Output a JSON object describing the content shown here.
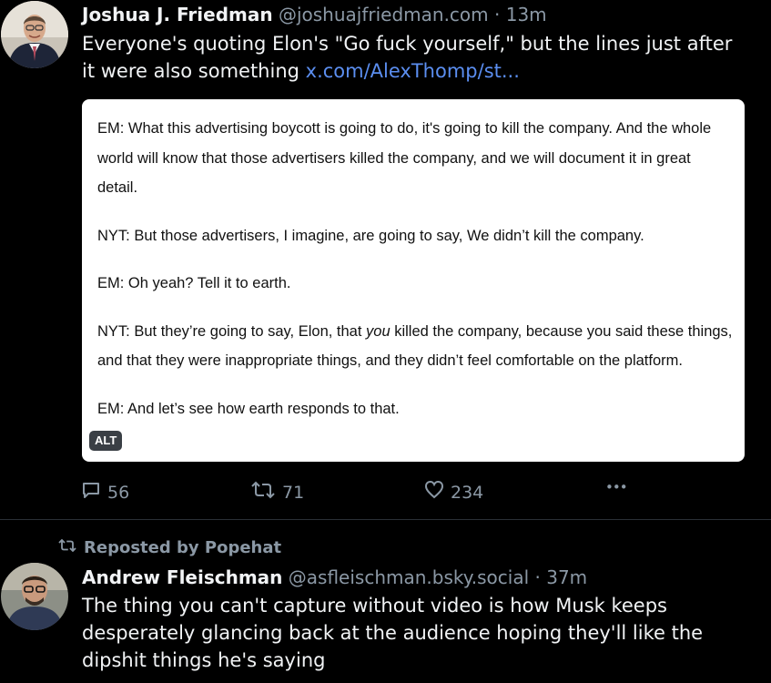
{
  "post1": {
    "author_name": "Joshua J. Friedman",
    "handle": "@joshuajfriedman.com",
    "separator": "·",
    "time": "13m",
    "text": "Everyone's quoting Elon's \"Go fuck yourself,\" but the lines just after it were also something ",
    "link": "x.com/AlexThomp/st...",
    "embed": {
      "p1": "EM: What this advertising boycott is going to do, it's going to kill the company. And the whole world will know that those advertisers killed the company, and we will document it in great detail.",
      "p2": "NYT: But those advertisers, I imagine, are going to say, We didn’t kill the company.",
      "p3": "EM: Oh yeah? Tell it to earth.",
      "p4_a": "NYT: But they’re going to say, Elon, that ",
      "p4_em": "you",
      "p4_b": " killed the company, because you said these things, and that they were inappropriate things, and they didn’t feel comfortable on the platform.",
      "p5": "EM: And let’s see how earth responds to that.",
      "alt_label": "ALT"
    },
    "replies": "56",
    "reposts": "71",
    "likes": "234",
    "more_label": "•••"
  },
  "repost_label": "Reposted by Popehat",
  "post2": {
    "author_name": "Andrew Fleischman",
    "handle": "@asfleischman.bsky.social",
    "separator": "·",
    "time": "37m",
    "text": "The thing you can't capture without video is how Musk keeps desperately glancing back at the audience hoping they'll like the dipshit things he's saying"
  },
  "icons": {
    "reply": "speech-bubble-icon",
    "repost": "repost-arrows-icon",
    "like": "heart-icon",
    "more": "ellipsis-icon"
  }
}
